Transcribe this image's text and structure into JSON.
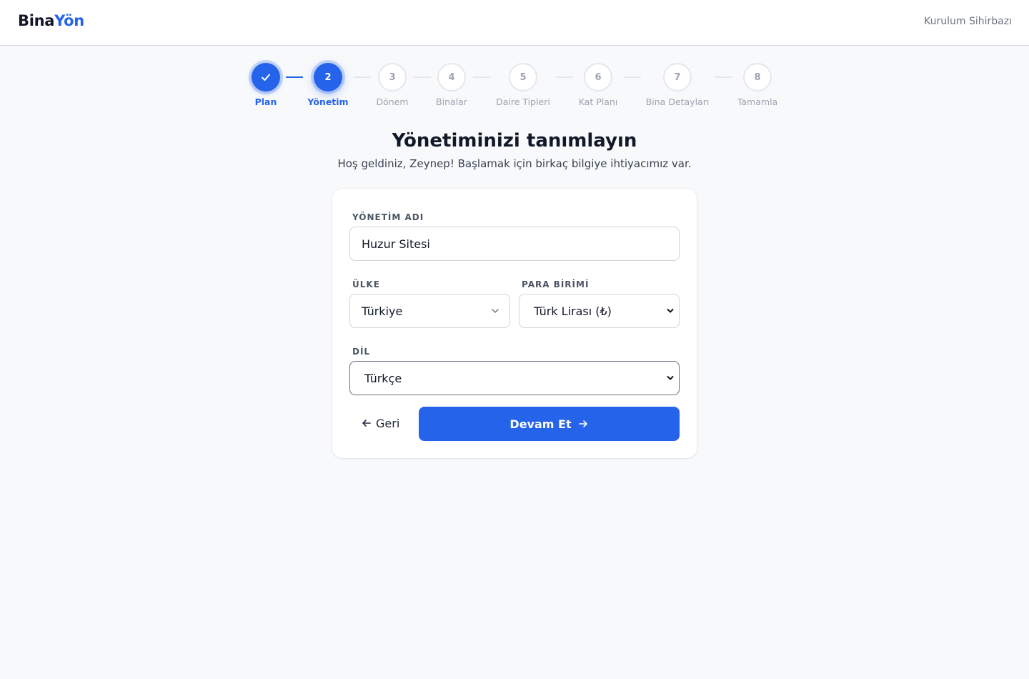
{
  "header": {
    "logo_part1": "Bina",
    "logo_part2": "Yön",
    "wizard_label": "Kurulum Sihirbazı"
  },
  "stepper": {
    "steps": [
      {
        "number": "1",
        "label": "Plan",
        "state": "completed",
        "icon": "check-icon"
      },
      {
        "number": "2",
        "label": "Yönetim",
        "state": "active"
      },
      {
        "number": "3",
        "label": "Dönem",
        "state": "pending"
      },
      {
        "number": "4",
        "label": "Binalar",
        "state": "pending"
      },
      {
        "number": "5",
        "label": "Daire Tipleri",
        "state": "pending"
      },
      {
        "number": "6",
        "label": "Kat Planı",
        "state": "pending"
      },
      {
        "number": "7",
        "label": "Bina Detayları",
        "state": "pending"
      },
      {
        "number": "8",
        "label": "Tamamla",
        "state": "pending"
      }
    ]
  },
  "page": {
    "title": "Yönetiminizi tanımlayın",
    "subtitle": "Hoş geldiniz, Zeynep! Başlamak için birkaç bilgiye ihtiyacımız var."
  },
  "form": {
    "management_name_label": "YÖNETİM ADI",
    "management_name_value": "Huzur Sitesi",
    "country_label": "ÜLKE",
    "country_value": "Türkiye",
    "currency_label": "PARA BİRİMİ",
    "currency_value": "Türk Lirası (₺)",
    "language_label": "DİL",
    "language_value": "Türkçe"
  },
  "actions": {
    "back_label": "Geri",
    "back_icon": "arrow-left-icon",
    "continue_label": "Devam Et",
    "continue_icon": "arrow-right-icon"
  },
  "colors": {
    "accent": "#2563eb",
    "background": "#f8f9fb",
    "card": "#ffffff",
    "pending": "#9ca3af"
  }
}
